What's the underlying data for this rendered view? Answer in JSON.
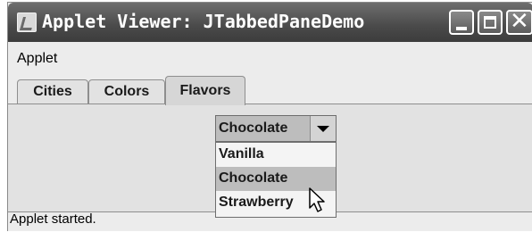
{
  "window": {
    "title": "Applet Viewer: JTabbedPaneDemo",
    "controls": [
      "minimize-icon",
      "maximize-icon",
      "close-icon"
    ]
  },
  "menubar": {
    "items": [
      "Applet"
    ]
  },
  "tabs": [
    {
      "label": "Cities",
      "selected": false
    },
    {
      "label": "Colors",
      "selected": false
    },
    {
      "label": "Flavors",
      "selected": true
    }
  ],
  "combo": {
    "selected": "Chocolate",
    "options": [
      "Vanilla",
      "Chocolate",
      "Strawberry"
    ],
    "highlighted_index": 1
  },
  "status": {
    "text": "Applet started."
  },
  "colors": {
    "titlebar": "#4a4a4a",
    "panel": "#e2e2e2",
    "highlight": "#bdbdbd"
  }
}
